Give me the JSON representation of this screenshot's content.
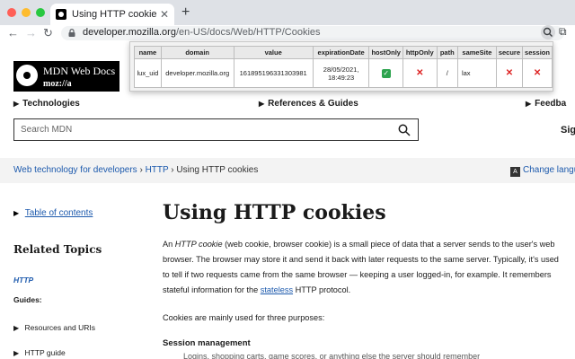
{
  "browser": {
    "tab_title": "Using HTTP cookies - HTTP | MDN",
    "new_tab_icon": "plus-icon",
    "url_host": "developer.mozilla.org",
    "url_path": "/en-US/docs/Web/HTTP/Cookies",
    "traffic_lights": [
      "#ff5f57",
      "#febc2e",
      "#28c840"
    ]
  },
  "popup": {
    "headers": [
      "name",
      "domain",
      "value",
      "expirationDate",
      "hostOnly",
      "httpOnly",
      "path",
      "sameSite",
      "secure",
      "session"
    ],
    "row": {
      "name": "lux_uid",
      "domain": "developer.mozilla.org",
      "value": "161895196331303981",
      "expiration_line1": "28/05/2021,",
      "expiration_line2": "18:49:23",
      "path": "/",
      "sameSite": "lax"
    }
  },
  "site": {
    "logo_title": "MDN Web Docs",
    "logo_sub": "moz://a",
    "nav": [
      "Technologies",
      "References & Guides",
      "Feedba"
    ],
    "search_placeholder": "Search MDN",
    "signin": "Sig"
  },
  "breadcrumb": {
    "items": [
      "Web technology for developers",
      "HTTP"
    ],
    "current": "Using HTTP cookies",
    "change_lang": "Change langu"
  },
  "sidebar": {
    "toc": "Table of contents",
    "related": "Related Topics",
    "http": "HTTP",
    "guides": "Guides:",
    "links": [
      "Resources and URIs",
      "HTTP guide"
    ]
  },
  "article": {
    "title": "Using HTTP cookies",
    "p1_a": "An ",
    "p1_em": "HTTP cookie",
    "p1_b": " (web cookie, browser cookie) is a small piece of data that a server sends to the user's web browser. The browser may store it and send it back with later requests to the same server. Typically, it's used to tell if two requests came from the same browser — keeping a user logged-in, for example. It remembers stateful information for the ",
    "p1_link": "stateless",
    "p1_c": " HTTP protocol.",
    "p2": "Cookies are mainly used for three purposes:",
    "h3": "Session management",
    "cutline": "Logins, shopping carts, game scores, or anything else the server should remember"
  }
}
